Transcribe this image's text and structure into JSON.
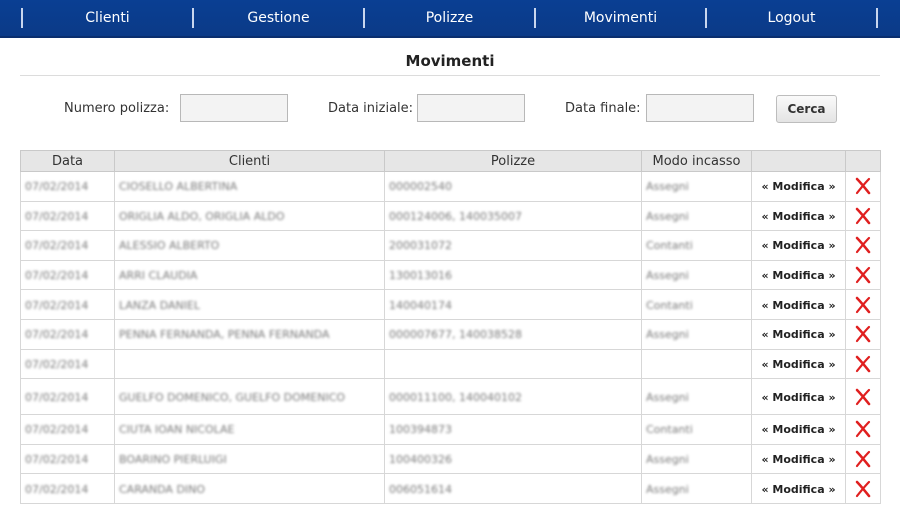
{
  "nav": {
    "items": [
      "Clienti",
      "Gestione",
      "Polizze",
      "Movimenti",
      "Logout"
    ]
  },
  "page": {
    "title": "Movimenti"
  },
  "search": {
    "numero_label": "Numero polizza:",
    "numero_value": "",
    "data_iniziale_label": "Data iniziale:",
    "data_iniziale_value": "",
    "data_finale_label": "Data finale:",
    "data_finale_value": "",
    "button_label": "Cerca"
  },
  "table": {
    "headers": [
      "Data",
      "Clienti",
      "Polizze",
      "Modo incasso",
      "",
      ""
    ],
    "action_label": "« Modifica »",
    "delete_color": "#e01f1f",
    "rows": [
      {
        "data": "07/02/2014",
        "clienti": "CIOSELLO ALBERTINA",
        "polizze": "000002540",
        "modo": "Assegni"
      },
      {
        "data": "07/02/2014",
        "clienti": "ORIGLIA ALDO, ORIGLIA ALDO",
        "polizze": "000124006, 140035007",
        "modo": "Assegni"
      },
      {
        "data": "07/02/2014",
        "clienti": "ALESSIO ALBERTO",
        "polizze": "200031072",
        "modo": "Contanti"
      },
      {
        "data": "07/02/2014",
        "clienti": "ARRI CLAUDIA",
        "polizze": "130013016",
        "modo": "Assegni"
      },
      {
        "data": "07/02/2014",
        "clienti": "LANZA DANIEL",
        "polizze": "140040174",
        "modo": "Contanti"
      },
      {
        "data": "07/02/2014",
        "clienti": "PENNA FERNANDA, PENNA FERNANDA",
        "polizze": "000007677, 140038528",
        "modo": "Assegni"
      },
      {
        "data": "07/02/2014",
        "clienti": "",
        "polizze": "",
        "modo": ""
      },
      {
        "data": "07/02/2014",
        "clienti": "GUELFO DOMENICO, GUELFO DOMENICO",
        "polizze": "000011100, 140040102",
        "modo": "Assegni",
        "tall": true
      },
      {
        "data": "07/02/2014",
        "clienti": "CIUTA IOAN NICOLAE",
        "polizze": "100394873",
        "modo": "Contanti"
      },
      {
        "data": "07/02/2014",
        "clienti": "BOARINO PIERLUIGI",
        "polizze": "100400326",
        "modo": "Assegni"
      },
      {
        "data": "07/02/2014",
        "clienti": "CARANDA DINO",
        "polizze": "006051614",
        "modo": "Assegni"
      }
    ]
  }
}
